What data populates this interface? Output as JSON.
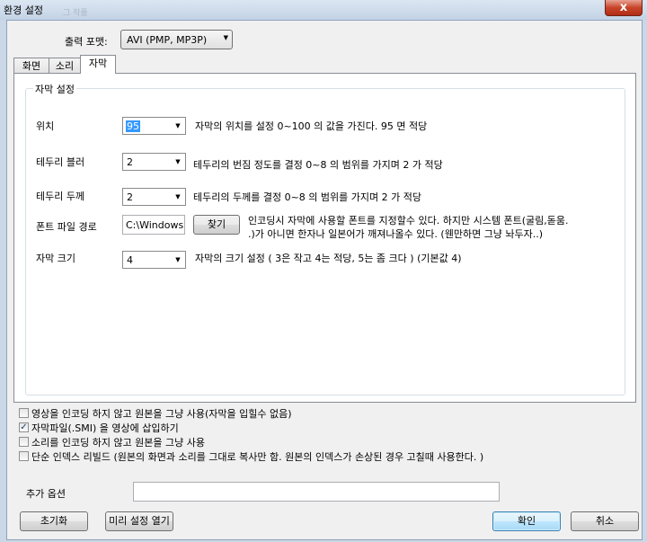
{
  "window": {
    "title": "환경 설정",
    "title_ghost": "그 작품",
    "close_glyph": "x"
  },
  "output_format": {
    "label": "출력 포맷:",
    "value": "AVI (PMP, MP3P)"
  },
  "tabs": [
    {
      "label": "화면",
      "active": false
    },
    {
      "label": "소리",
      "active": false
    },
    {
      "label": "자막",
      "active": true
    }
  ],
  "subtitle_settings": {
    "group_title": "자막 설정",
    "position": {
      "label": "위치",
      "value": "95",
      "desc": "자막의 위치를 설정 0~100 의 값을 가진다. 95 면 적당"
    },
    "edge_blur": {
      "label": "테두리 블러",
      "value": "2",
      "desc": "테두리의 번짐 정도를 결정  0~8 의 범위를 가지며 2 가 적당"
    },
    "edge_thickness": {
      "label": "테두리 두께",
      "value": "2",
      "desc": "테두리의 두께를 결정  0~8 의 범위를 가지며 2 가 적당"
    },
    "font_path": {
      "label": "폰트 파일 경로",
      "value": "C:\\Windows",
      "browse_label": "찾기",
      "desc_line1": "인코딩시 자막에 사용할 폰트를 지정할수 있다. 하지만 시스템 폰트(굴림,돋움.",
      "desc_line2": ".)가 아니면 한자나 일본어가 깨져나올수 있다. (웬만하면 그냥 놔두자..)"
    },
    "size": {
      "label": "자막 크기",
      "value": "4",
      "desc": "자막의 크기 설정 ( 3은 작고 4는 적당, 5는 좀 크다 ) (기본값 4)"
    }
  },
  "options": [
    {
      "label": "영상을 인코딩 하지 않고 원본을 그냥 사용(자막을 입힐수 없음)",
      "checked": false
    },
    {
      "label": "자막파일(.SMI) 을 영상에 삽입하기",
      "checked": true
    },
    {
      "label": "소리를 인코딩 하지 않고 원본을 그냥 사용",
      "checked": false
    },
    {
      "label": "단순 인덱스 리빌드 (원본의 화면과 소리를 그대로 복사만 함. 원본의 인덱스가 손상된 경우 고칠때 사용한다. )",
      "checked": false
    }
  ],
  "extra_options": {
    "label": "추가 옵션",
    "value": ""
  },
  "buttons": {
    "reset": "초기화",
    "open_preset": "미리 설정 열기",
    "ok": "확인",
    "cancel": "취소"
  },
  "check_glyph": "✓",
  "dropdown_glyph": "▼"
}
